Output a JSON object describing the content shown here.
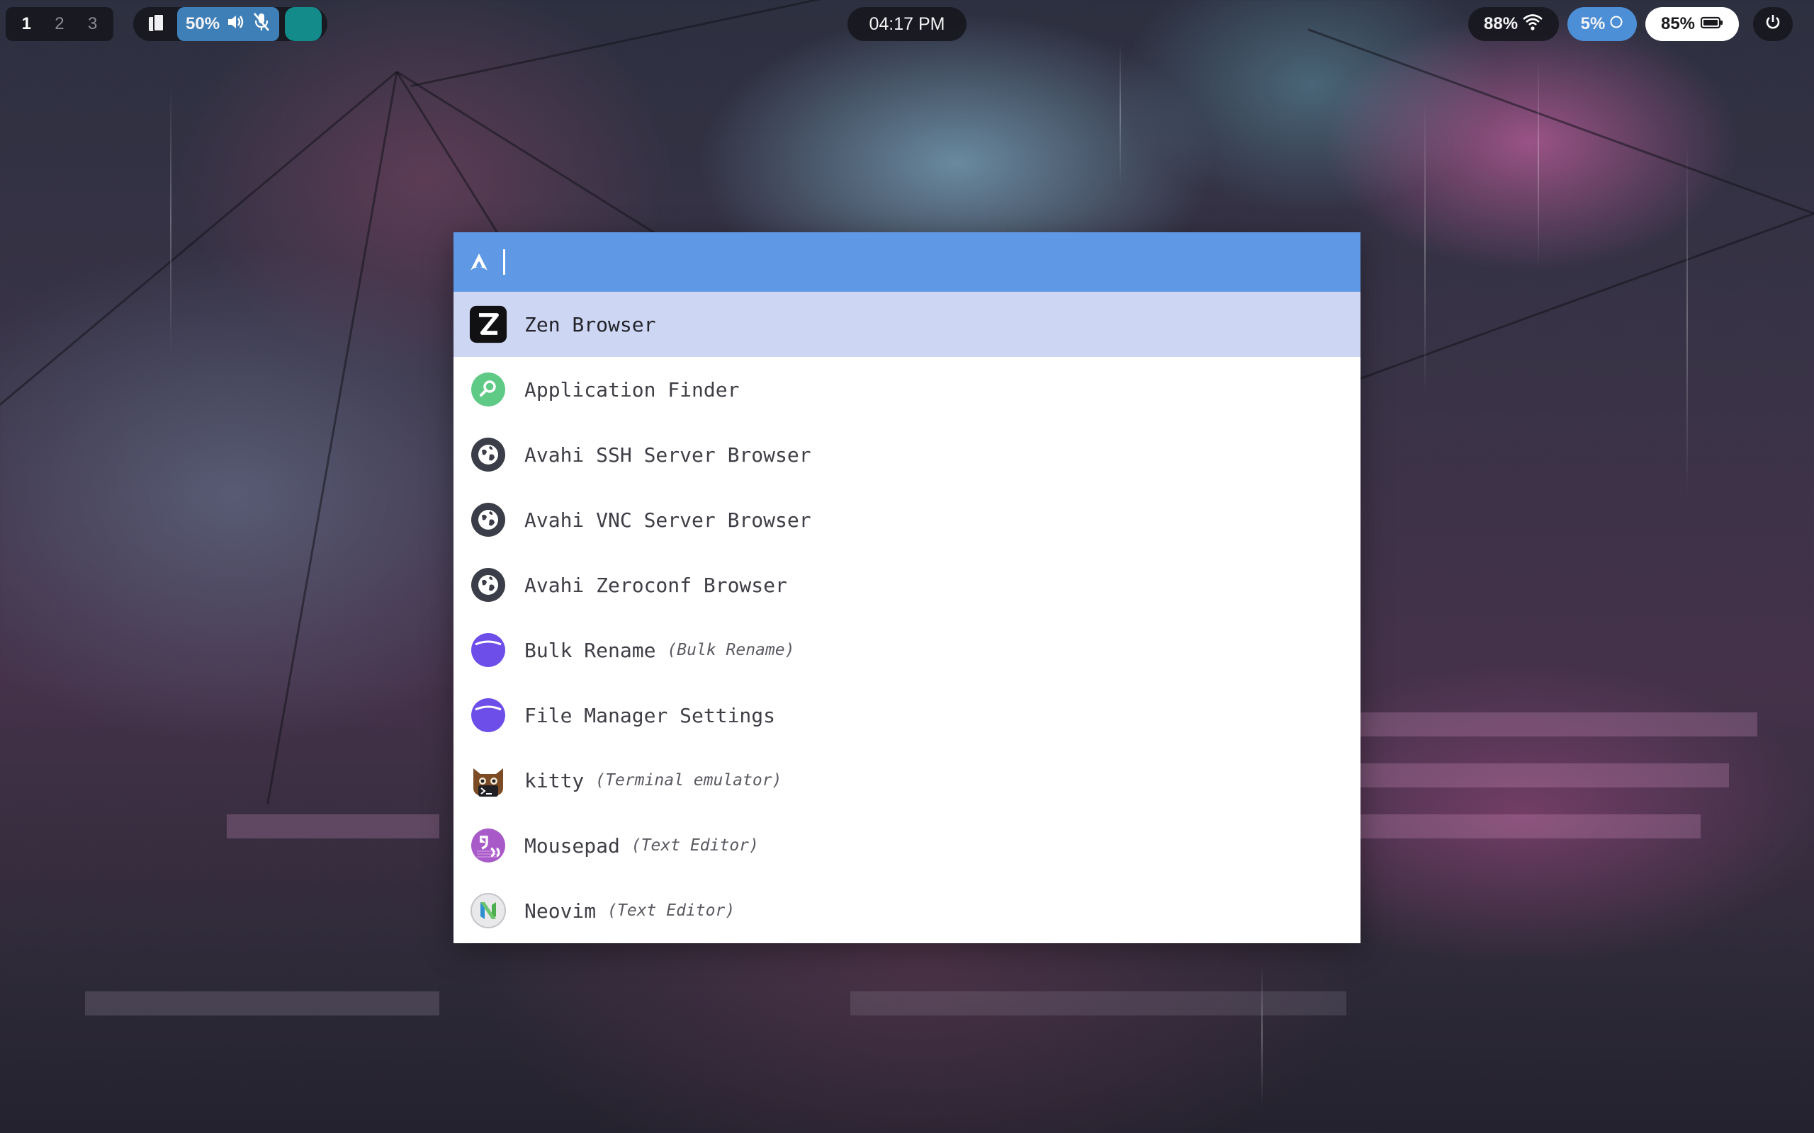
{
  "topbar": {
    "workspaces": [
      "1",
      "2",
      "3"
    ],
    "active_workspace": "1",
    "volume": "50%",
    "clock": "04:17 PM",
    "wifi": "88%",
    "cpu": "5%",
    "battery": "85%",
    "icons": {
      "clipboard": "clipboard-icon",
      "speaker": "speaker-icon",
      "mic": "mic-muted-icon",
      "wifi": "wifi-icon",
      "cpu": "cpu-ring-icon",
      "battery": "battery-icon",
      "power": "power-icon"
    },
    "colors": {
      "volume_bg": "#3f7fb7",
      "teal": "#138b8b",
      "cpu_bg": "#4d8fd6",
      "battery_bg": "#ffffff"
    }
  },
  "launcher": {
    "query": "",
    "prompt_icon": "arch-logo-icon",
    "accent": "#5f98e4",
    "selected_bg": "#cdd6f2",
    "items": [
      {
        "name": "Zen Browser",
        "sub": "",
        "icon": "zen-browser-icon"
      },
      {
        "name": "Application Finder",
        "sub": "",
        "icon": "app-finder-icon"
      },
      {
        "name": "Avahi SSH Server Browser",
        "sub": "",
        "icon": "globe-icon"
      },
      {
        "name": "Avahi VNC Server Browser",
        "sub": "",
        "icon": "globe-icon"
      },
      {
        "name": "Avahi Zeroconf Browser",
        "sub": "",
        "icon": "globe-icon"
      },
      {
        "name": "Bulk Rename",
        "sub": "(Bulk Rename)",
        "icon": "folder-purple-icon"
      },
      {
        "name": "File Manager Settings",
        "sub": "",
        "icon": "folder-purple-icon"
      },
      {
        "name": "kitty",
        "sub": "(Terminal emulator)",
        "icon": "kitty-icon"
      },
      {
        "name": "Mousepad",
        "sub": "(Text Editor)",
        "icon": "mousepad-icon"
      },
      {
        "name": "Neovim",
        "sub": "(Text Editor)",
        "icon": "neovim-icon"
      }
    ]
  }
}
